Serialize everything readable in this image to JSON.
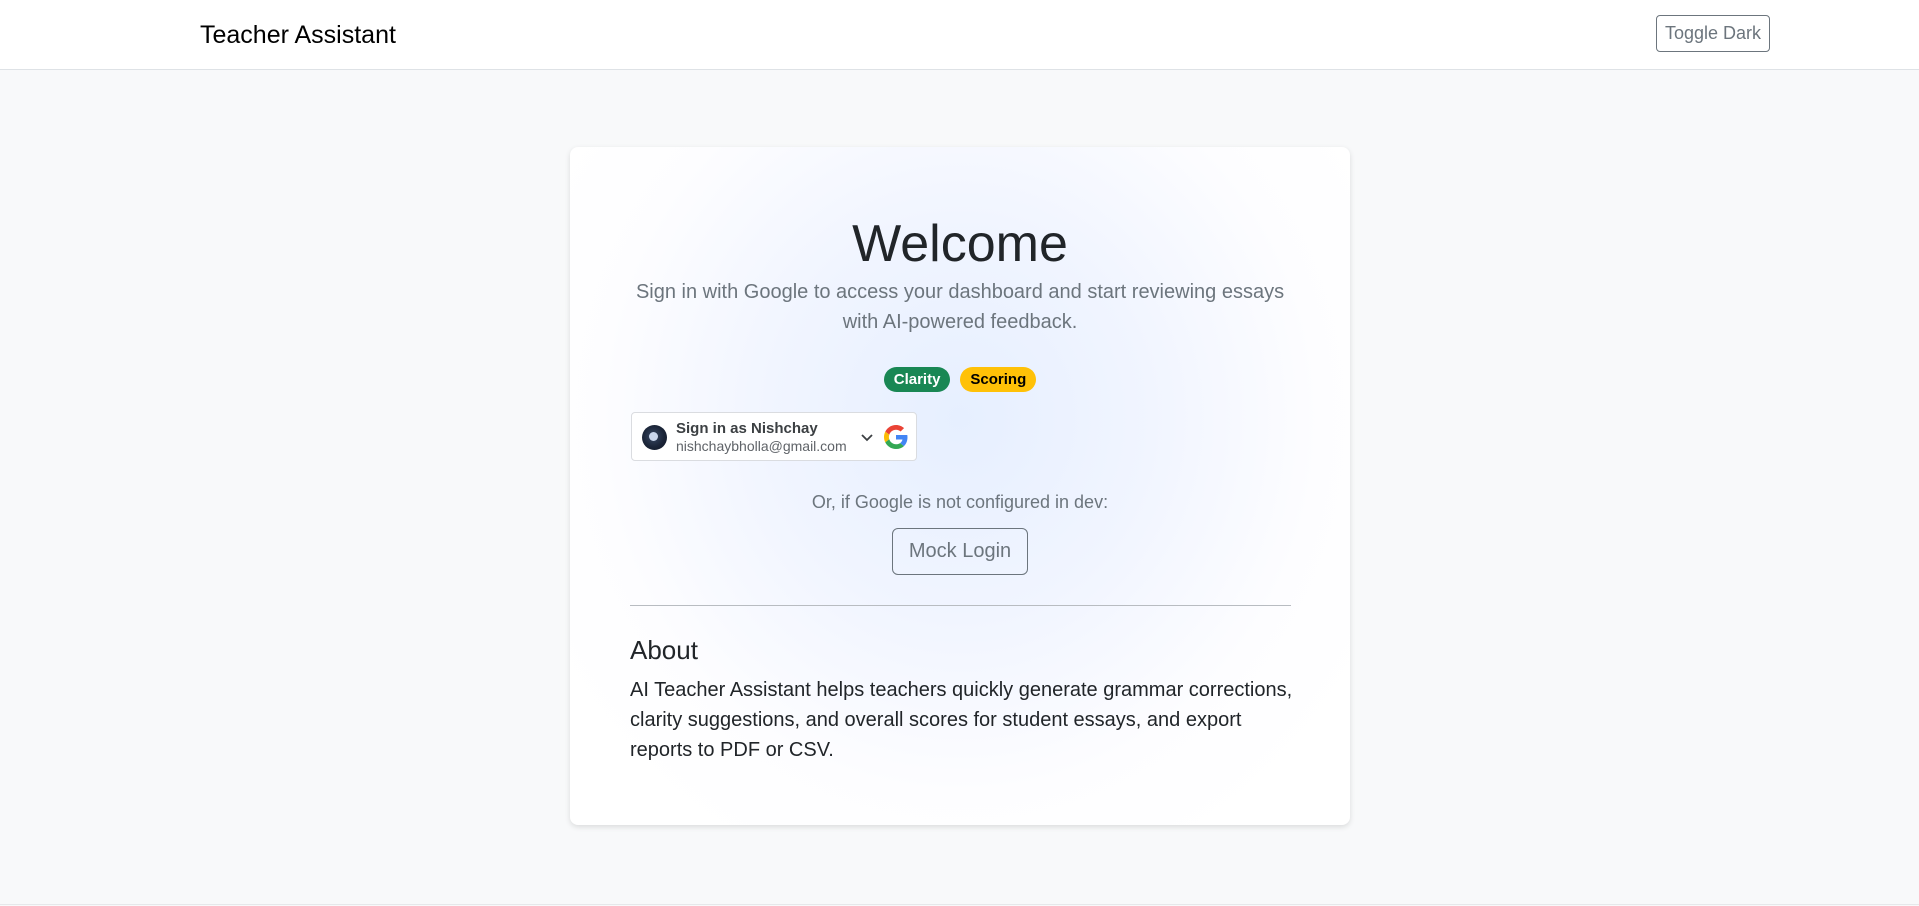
{
  "navbar": {
    "brand": "Teacher Assistant",
    "toggle_label": "Toggle Dark"
  },
  "card": {
    "title": "Welcome",
    "lead": "Sign in with Google to access your dashboard and start reviewing essays with AI-powered feedback.",
    "badges": [
      {
        "label": "Clarity",
        "color": "#198754"
      },
      {
        "label": "Scoring",
        "color": "#ffc107"
      }
    ],
    "google_signin": {
      "name_line": "Sign in as Nishchay",
      "email": "nishchaybholla@gmail.com",
      "avatar_icon": "avatar-icon",
      "chevron_icon": "chevron-down-icon",
      "logo_icon": "google-logo-icon"
    },
    "dev_note": "Or, if Google is not configured in dev:",
    "mock_login_label": "Mock Login",
    "about": {
      "title": "About",
      "text": "AI Teacher Assistant helps teachers quickly generate grammar corrections, clarity suggestions, and overall scores for student essays, and export reports to PDF or CSV."
    }
  },
  "colors": {
    "background": "#f8f9fa",
    "badge_green": "#198754",
    "badge_yellow": "#ffc107",
    "secondary": "#6c757d"
  }
}
